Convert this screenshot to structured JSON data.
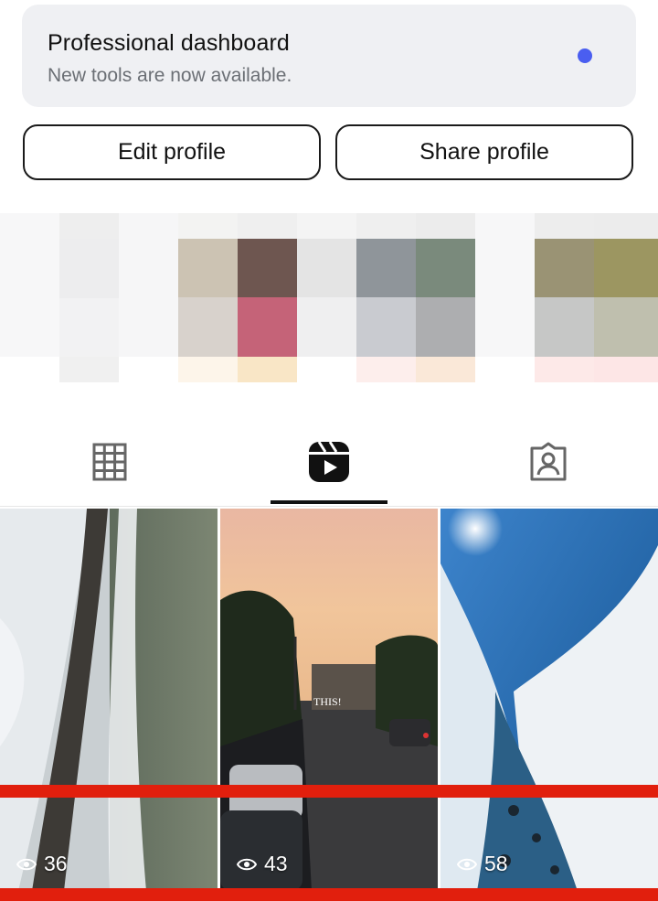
{
  "dashboard": {
    "title": "Professional dashboard",
    "subtitle": "New tools are now available.",
    "dot_color": "#4a5ef0"
  },
  "buttons": {
    "edit": "Edit profile",
    "share": "Share profile"
  },
  "tabs": [
    {
      "name": "grid-icon",
      "active": false
    },
    {
      "name": "reels-icon",
      "active": true
    },
    {
      "name": "tagged-icon",
      "active": false
    }
  ],
  "reels": [
    {
      "views": "36"
    },
    {
      "views": "43",
      "overlay_text": "THIS!"
    },
    {
      "views": "58"
    }
  ],
  "colors": {
    "highlight_bar": "#e11f0d",
    "text": "#111111"
  }
}
